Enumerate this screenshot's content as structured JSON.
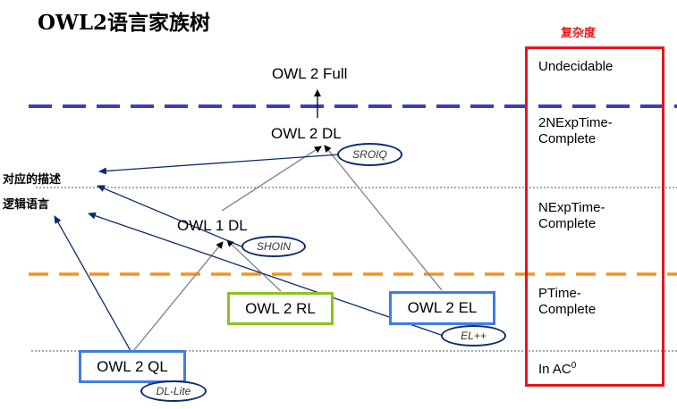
{
  "title": "OWL2语言家族树",
  "complexity": {
    "heading": "复杂度",
    "levels": [
      {
        "line1": "Undecidable",
        "line2": ""
      },
      {
        "line1": "2NExpTime-",
        "line2": "Complete"
      },
      {
        "line1": "NExpTime-",
        "line2": "Complete"
      },
      {
        "line1": "PTime-",
        "line2": "Complete"
      },
      {
        "line1": "In AC",
        "line2": "",
        "sup": "0"
      }
    ]
  },
  "nodes": {
    "owl2_full": "OWL 2 Full",
    "owl2_dl": "OWL 2 DL",
    "owl1_dl": "OWL 1 DL",
    "owl2_rl": "OWL 2 RL",
    "owl2_el": "OWL 2 EL",
    "owl2_ql": "OWL 2 QL"
  },
  "logics": {
    "sroiq": "SROIQ",
    "shoin": "SHOIN",
    "el_pp": "EL++",
    "dl_lite": "DL-Lite"
  },
  "side_label": {
    "line1": "对应的描述",
    "line2": "逻辑语言"
  },
  "colors": {
    "complexity_border": "#e8141b",
    "undecidable_divider": "#3d3dbf",
    "ptime_divider": "#f7941d",
    "rl_box": "#8dc21f",
    "el_ql_box": "#3d7de8",
    "logic_oval": "#0d2a6e"
  }
}
